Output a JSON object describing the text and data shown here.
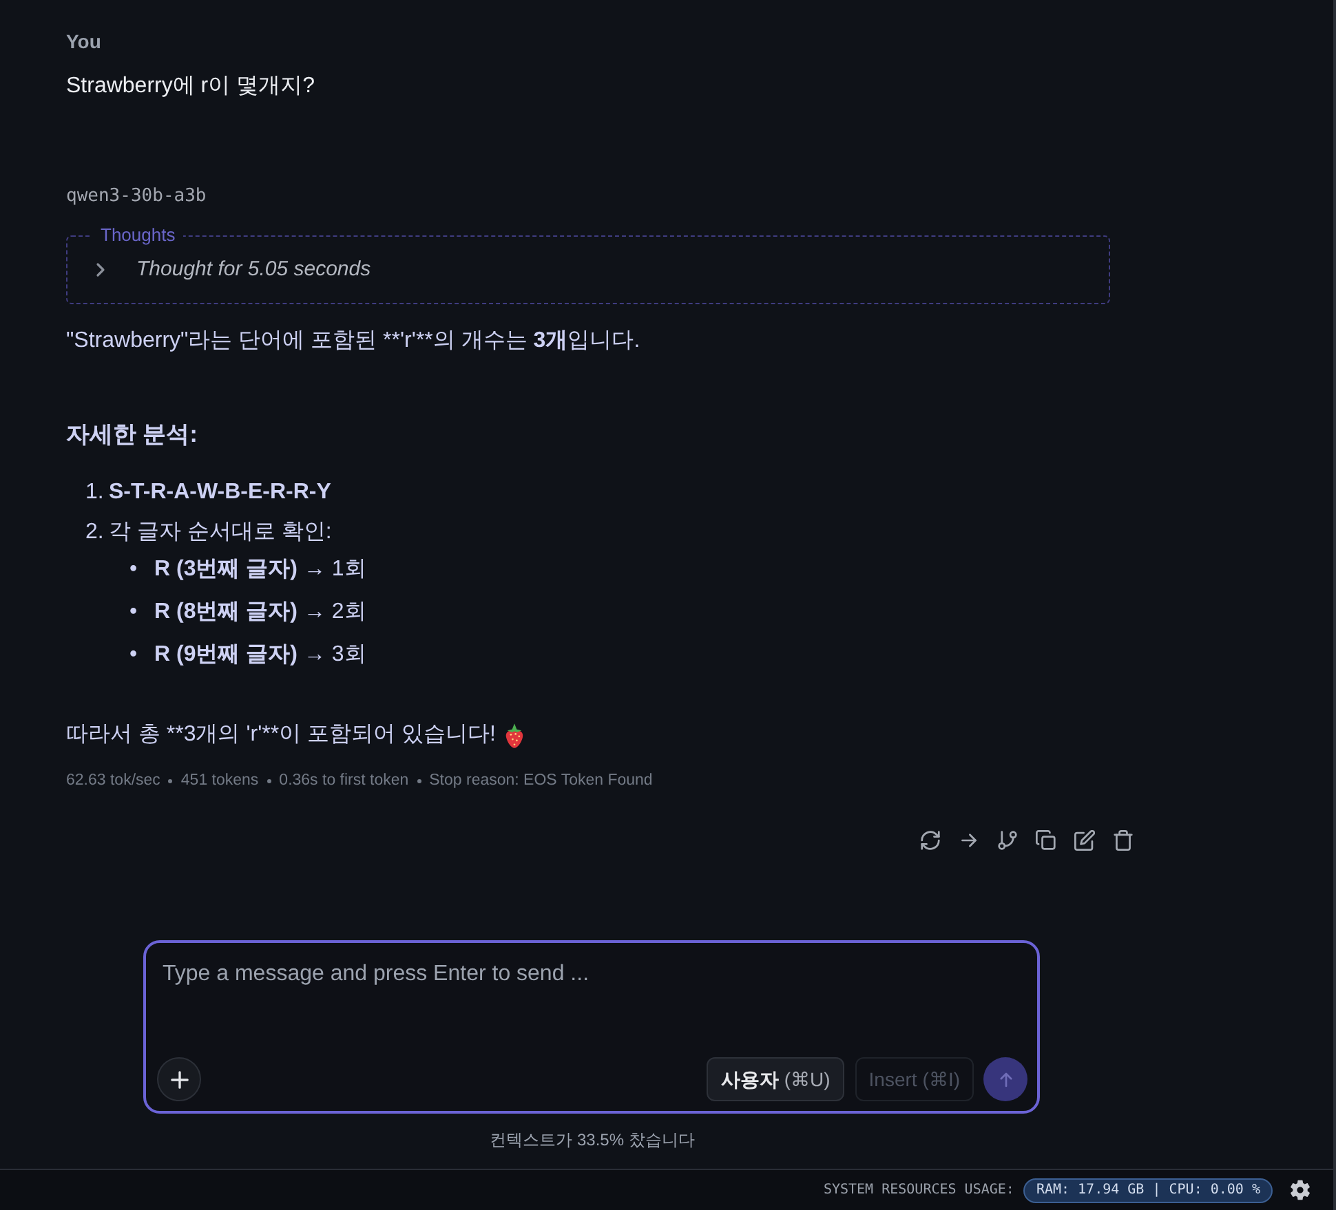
{
  "messages": [
    {
      "kind": "user",
      "author": "You",
      "text": "Strawberry에 r이 몇개지?"
    },
    {
      "kind": "assistant",
      "model": "qwen3-30b-a3b",
      "thoughts": {
        "legend": "Thoughts",
        "summary": "Thought for 5.05 seconds",
        "expanded": false
      },
      "blocks": [
        {
          "kind": "paragraph",
          "runs": [
            {
              "text": "\"Strawberry\"라는 단어에 포함된 **'r'**의 개수는 ",
              "bold": false
            },
            {
              "text": "3개",
              "bold": true
            },
            {
              "text": "입니다.",
              "bold": false
            }
          ]
        },
        {
          "kind": "heading",
          "text": "자세한 분석:"
        },
        {
          "kind": "ordered_list",
          "items": [
            {
              "marker": "1.",
              "runs": [
                {
                  "text": "S-T-R-A-W-B-E-R-R-Y",
                  "bold": true
                }
              ]
            },
            {
              "marker": "2.",
              "runs": [
                {
                  "text": "각 글자 순서대로 확인:",
                  "bold": false
                }
              ],
              "children": [
                {
                  "marker": "•",
                  "runs": [
                    {
                      "text": "R (3번째 글자)",
                      "bold": true
                    },
                    {
                      "text": " → 1회",
                      "bold": false
                    }
                  ]
                },
                {
                  "marker": "•",
                  "runs": [
                    {
                      "text": "R (8번째 글자)",
                      "bold": true
                    },
                    {
                      "text": " → 2회",
                      "bold": false
                    }
                  ]
                },
                {
                  "marker": "•",
                  "runs": [
                    {
                      "text": "R (9번째 글자)",
                      "bold": true
                    },
                    {
                      "text": " → 3회",
                      "bold": false
                    }
                  ]
                }
              ]
            }
          ]
        },
        {
          "kind": "paragraph",
          "runs": [
            {
              "text": "따라서 총 **3개의 'r'**이 포함되어 있습니다!",
              "bold": false
            }
          ],
          "trailing_emoji": true
        }
      ],
      "stats": [
        "62.63 tok/sec",
        "451 tokens",
        "0.36s to first token",
        "Stop reason: EOS Token Found"
      ]
    }
  ],
  "composer": {
    "placeholder": "Type a message and press Enter to send ...",
    "buttons": [
      {
        "kind": "role",
        "label": "사용자",
        "shortcut": "(⌘U)",
        "disabled": false
      },
      {
        "kind": "insert",
        "label": "Insert",
        "shortcut": "(⌘I)",
        "disabled": true
      }
    ],
    "send": {
      "disabled": true
    }
  },
  "context_usage": "컨텍스트가 33.5% 찼습니다",
  "status_bar": {
    "label": "SYSTEM RESOURCES USAGE:",
    "resources": "RAM: 17.94 GB | CPU: 0.00 %"
  }
}
